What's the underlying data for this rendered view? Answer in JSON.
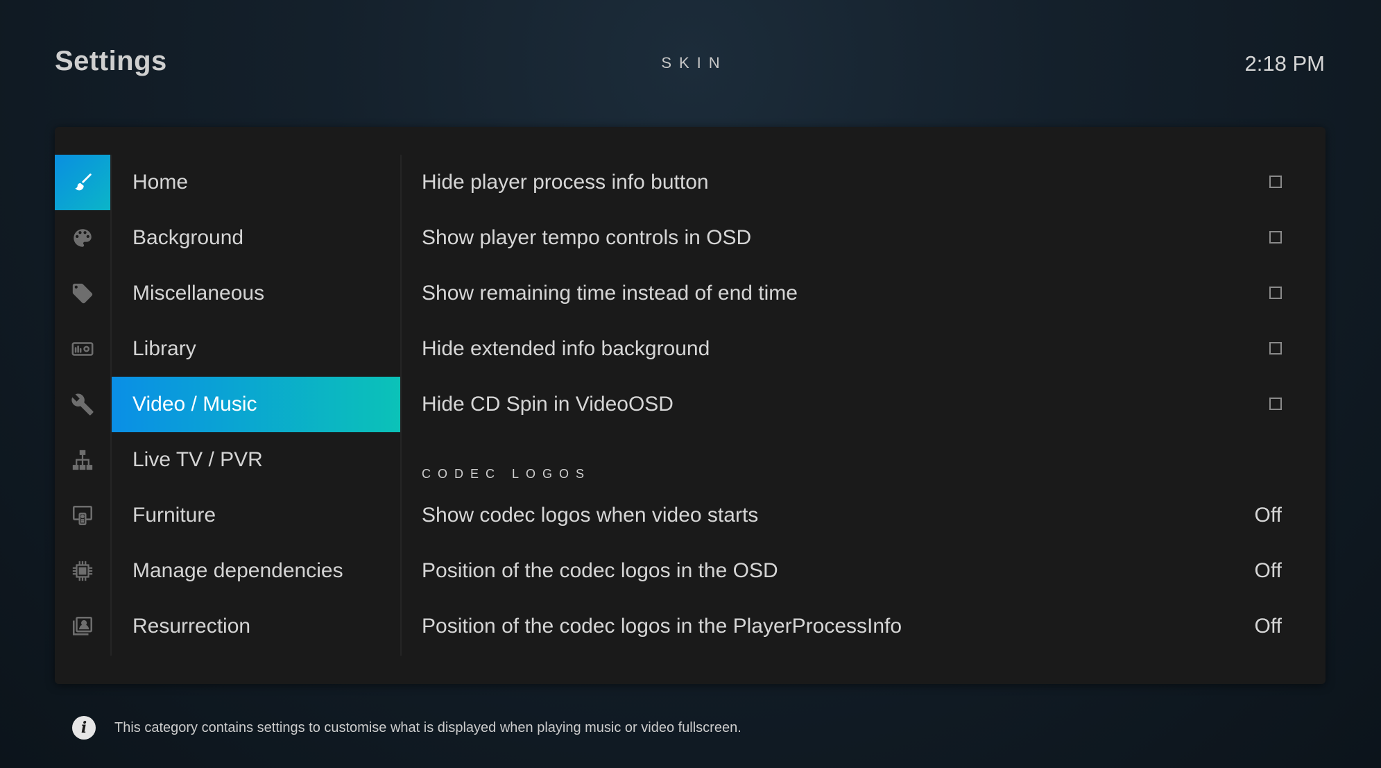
{
  "header": {
    "title": "Settings",
    "section": "SKIN",
    "clock": "2:18 PM"
  },
  "categories": [
    {
      "label": "Home",
      "icon": "paintbrush-icon",
      "active": false
    },
    {
      "label": "Background",
      "icon": "palette-icon",
      "active": false
    },
    {
      "label": "Miscellaneous",
      "icon": "tag-icon",
      "active": false
    },
    {
      "label": "Library",
      "icon": "library-icon",
      "active": false
    },
    {
      "label": "Video / Music",
      "icon": "wrench-icon",
      "active": true
    },
    {
      "label": "Live TV / PVR",
      "icon": "network-icon",
      "active": false
    },
    {
      "label": "Furniture",
      "icon": "remote-icon",
      "active": false
    },
    {
      "label": "Manage dependencies",
      "icon": "chip-icon",
      "active": false
    },
    {
      "label": "Resurrection",
      "icon": "contact-icon",
      "active": false
    }
  ],
  "settings": [
    {
      "label": "Hide player process info button",
      "control": "checkbox",
      "checked": false
    },
    {
      "label": "Show player tempo controls in OSD",
      "control": "checkbox",
      "checked": false
    },
    {
      "label": "Show remaining time instead of end time",
      "control": "checkbox",
      "checked": false
    },
    {
      "label": "Hide extended info background",
      "control": "checkbox",
      "checked": false
    },
    {
      "label": "Hide CD Spin in VideoOSD",
      "control": "checkbox",
      "checked": false
    }
  ],
  "codec_group": {
    "header": "CODEC LOGOS",
    "settings": [
      {
        "label": "Show codec logos when video starts",
        "value": "Off"
      },
      {
        "label": "Position of the codec logos in the OSD",
        "value": "Off"
      },
      {
        "label": "Position of the codec logos in the PlayerProcessInfo",
        "value": "Off"
      }
    ]
  },
  "footer": {
    "icon": "info-icon",
    "text": "This category contains settings to customise what is displayed when playing music or video fullscreen."
  },
  "colors": {
    "accent_start": "#0a8fe6",
    "accent_end": "#0bc2b8",
    "panel": "#1a1a1a"
  }
}
